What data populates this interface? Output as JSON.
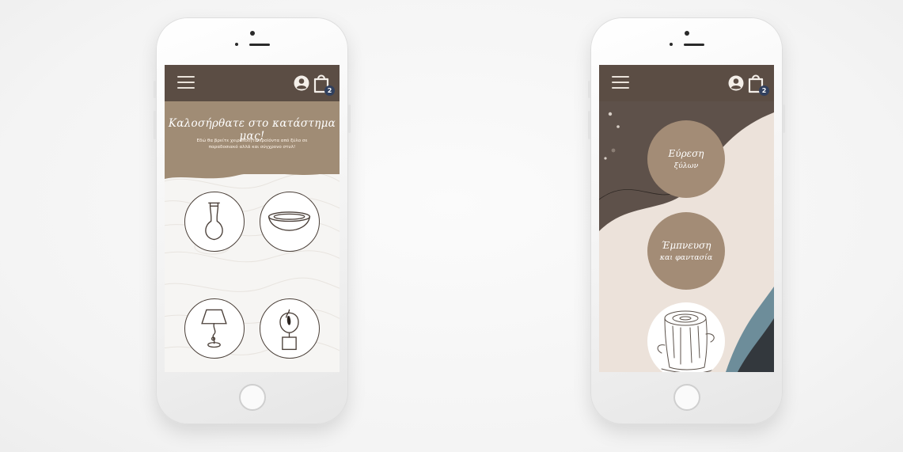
{
  "left_screen": {
    "header": {
      "cart_count": "2",
      "menu_icon": "hamburger-menu-icon",
      "account_icon": "user-account-icon",
      "cart_icon": "shopping-bag-icon"
    },
    "welcome": {
      "title": "Καλοσήρθατε στο κατάστημα μας!",
      "subtitle": "Εδώ θα βρείτε χειροποίητα προϊόντα από ξύλο σε παραδοσιακό αλλά και σύγχρονο στυλ!"
    },
    "products": [
      {
        "icon": "vase-icon"
      },
      {
        "icon": "bowl-icon"
      },
      {
        "icon": "lamp-icon"
      },
      {
        "icon": "candle-holder-icon"
      }
    ]
  },
  "right_screen": {
    "header": {
      "cart_count": "2",
      "menu_icon": "hamburger-menu-icon",
      "account_icon": "user-account-icon",
      "cart_icon": "shopping-bag-icon"
    },
    "categories": [
      {
        "line1": "Εύρεση",
        "line2": "ξύλων"
      },
      {
        "line1": "Έμπνευση",
        "line2": "και φαντασία"
      }
    ],
    "photo": {
      "icon": "tree-stump-icon"
    }
  },
  "colors": {
    "header": "#5b4d44",
    "welcome_band": "#a08c75",
    "circle_brown": "#a38c76",
    "badge": "#31405e",
    "cream": "#ece2da",
    "teal_accent": "#6d8d9a"
  }
}
